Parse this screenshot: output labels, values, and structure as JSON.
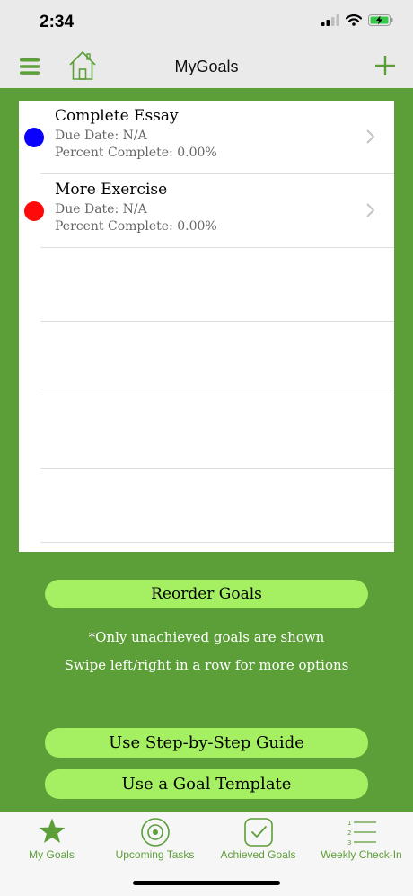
{
  "status_bar": {
    "time": "2:34"
  },
  "nav": {
    "title": "MyGoals"
  },
  "goals": [
    {
      "title": "Complete Essay",
      "due": "Due Date: N/A",
      "percent": "Percent Complete: 0.00%",
      "color": "#0a00ff"
    },
    {
      "title": "More Exercise",
      "due": "Due Date: N/A",
      "percent": "Percent Complete: 0.00%",
      "color": "#ff0a0a"
    }
  ],
  "reorder_label": "Reorder Goals",
  "notes": {
    "unachieved": "*Only unachieved goals are shown",
    "swipe": "Swipe left/right in a row for more options"
  },
  "guide_label": "Use Step-by-Step Guide",
  "template_label": "Use a Goal Template",
  "tabs": [
    {
      "label": "My Goals",
      "icon": "star-icon"
    },
    {
      "label": "Upcoming Tasks",
      "icon": "target-icon"
    },
    {
      "label": "Achieved Goals",
      "icon": "checkbox-icon"
    },
    {
      "label": "Weekly Check-In",
      "icon": "numbered-list-icon"
    }
  ],
  "colors": {
    "accent": "#5c9e38",
    "button": "#a4ef62"
  }
}
